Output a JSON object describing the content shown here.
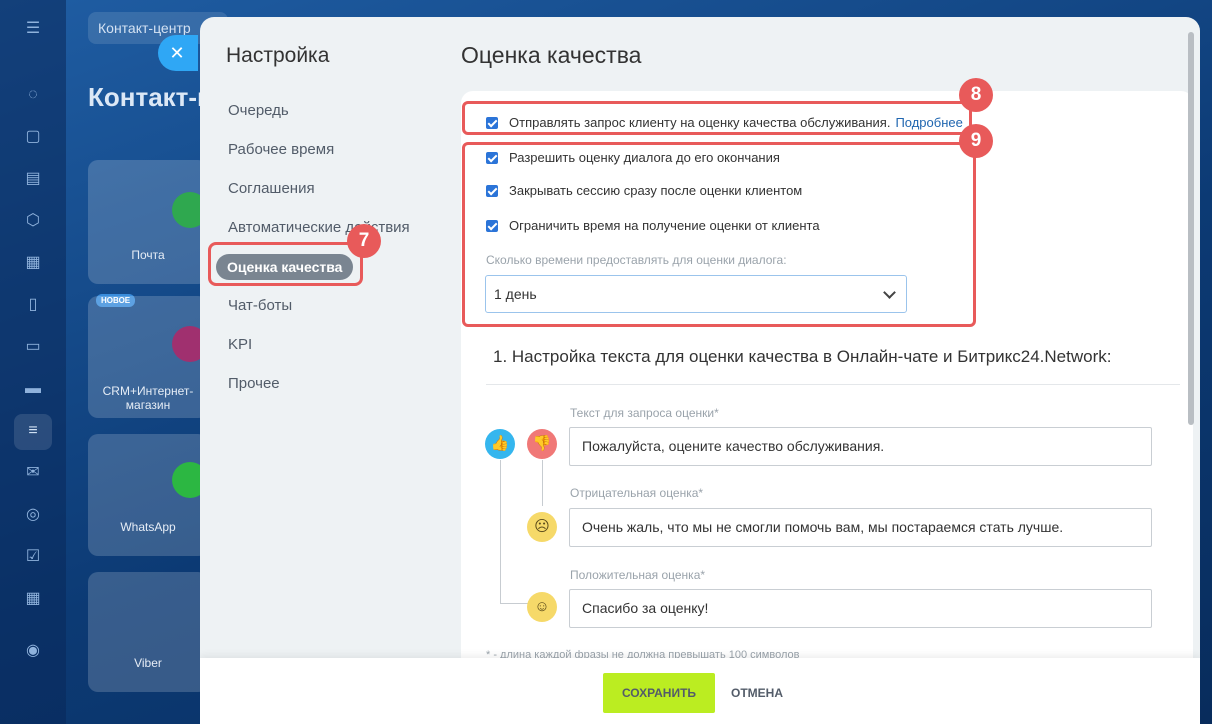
{
  "background": {
    "tab_label": "Контакт-центр",
    "page_title": "Контакт-центр",
    "new_badge": "НОВОЕ",
    "cards": [
      {
        "label": "Почта"
      },
      {
        "label": "CRM+Интернет-магазин"
      },
      {
        "label": "WhatsApp"
      },
      {
        "label": "Viber"
      }
    ]
  },
  "close_icon": "✕",
  "settings": {
    "title": "Настройка",
    "nav": [
      {
        "label": "Очередь"
      },
      {
        "label": "Рабочее время"
      },
      {
        "label": "Соглашения"
      },
      {
        "label": "Автоматические действия"
      },
      {
        "label": "Оценка качества",
        "active": true
      },
      {
        "label": "Чат-боты"
      },
      {
        "label": "KPI"
      },
      {
        "label": "Прочее"
      }
    ]
  },
  "callouts": {
    "nav": "7",
    "top_checkbox": "8",
    "options_group": "9"
  },
  "main": {
    "title": "Оценка качества",
    "checkboxes": [
      {
        "label": "Отправлять запрос клиенту на оценку качества обслуживания.",
        "link": "Подробнее",
        "checked": true
      },
      {
        "label": "Разрешить оценку диалога до его окончания",
        "checked": true
      },
      {
        "label": "Закрывать сессию сразу после оценки клиентом",
        "checked": true
      },
      {
        "label": "Ограничить время на получение оценки от клиента",
        "checked": true
      }
    ],
    "time_label": "Сколько времени предоставлять для оценки диалога:",
    "time_value": "1 день",
    "section_heading": "1. Настройка текста для оценки качества в Онлайн-чате и Битрикс24.Network:",
    "fields": {
      "request": {
        "label": "Текст для запроса оценки*",
        "value": "Пожалуйста, оцените качество обслуживания."
      },
      "negative": {
        "label": "Отрицательная оценка*",
        "value": "Очень жаль, что мы не смогли помочь вам, мы постараемся стать лучше."
      },
      "positive": {
        "label": "Положительная оценка*",
        "value": "Спасибо за оценку!"
      }
    },
    "footnote": "* - длина каждой фразы не должна превышать 100 символов"
  },
  "footer": {
    "save_label": "СОХРАНИТЬ",
    "cancel_label": "ОТМЕНА"
  },
  "colors": {
    "accent": "#2b74d8",
    "save": "#bbed21",
    "callout": "#e85a5a",
    "like": "#35b6ee",
    "dislike": "#f07877",
    "smiley": "#f6d969"
  }
}
